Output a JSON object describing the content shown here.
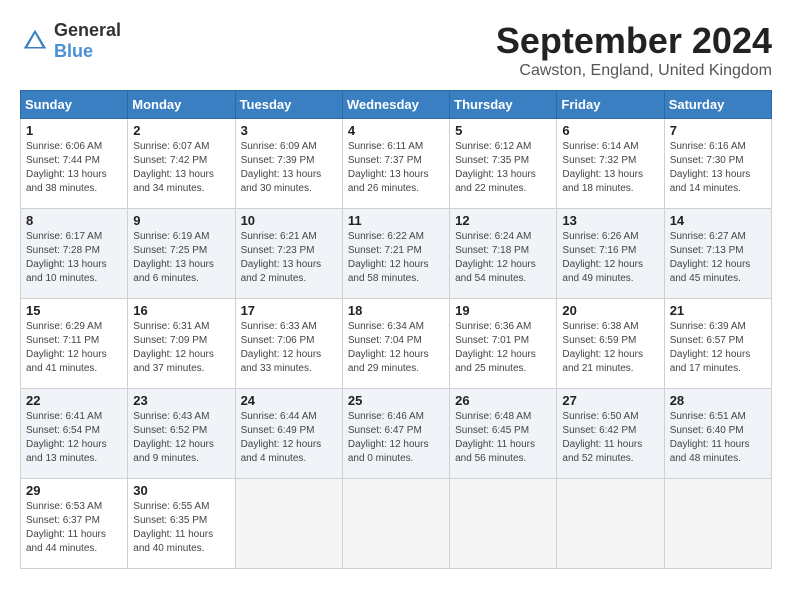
{
  "logo": {
    "text1": "General",
    "text2": "Blue"
  },
  "title": "September 2024",
  "location": "Cawston, England, United Kingdom",
  "weekdays": [
    "Sunday",
    "Monday",
    "Tuesday",
    "Wednesday",
    "Thursday",
    "Friday",
    "Saturday"
  ],
  "weeks": [
    [
      {
        "day": "1",
        "sunrise": "6:06 AM",
        "sunset": "7:44 PM",
        "daylight": "13 hours and 38 minutes."
      },
      {
        "day": "2",
        "sunrise": "6:07 AM",
        "sunset": "7:42 PM",
        "daylight": "13 hours and 34 minutes."
      },
      {
        "day": "3",
        "sunrise": "6:09 AM",
        "sunset": "7:39 PM",
        "daylight": "13 hours and 30 minutes."
      },
      {
        "day": "4",
        "sunrise": "6:11 AM",
        "sunset": "7:37 PM",
        "daylight": "13 hours and 26 minutes."
      },
      {
        "day": "5",
        "sunrise": "6:12 AM",
        "sunset": "7:35 PM",
        "daylight": "13 hours and 22 minutes."
      },
      {
        "day": "6",
        "sunrise": "6:14 AM",
        "sunset": "7:32 PM",
        "daylight": "13 hours and 18 minutes."
      },
      {
        "day": "7",
        "sunrise": "6:16 AM",
        "sunset": "7:30 PM",
        "daylight": "13 hours and 14 minutes."
      }
    ],
    [
      {
        "day": "8",
        "sunrise": "6:17 AM",
        "sunset": "7:28 PM",
        "daylight": "13 hours and 10 minutes."
      },
      {
        "day": "9",
        "sunrise": "6:19 AM",
        "sunset": "7:25 PM",
        "daylight": "13 hours and 6 minutes."
      },
      {
        "day": "10",
        "sunrise": "6:21 AM",
        "sunset": "7:23 PM",
        "daylight": "13 hours and 2 minutes."
      },
      {
        "day": "11",
        "sunrise": "6:22 AM",
        "sunset": "7:21 PM",
        "daylight": "12 hours and 58 minutes."
      },
      {
        "day": "12",
        "sunrise": "6:24 AM",
        "sunset": "7:18 PM",
        "daylight": "12 hours and 54 minutes."
      },
      {
        "day": "13",
        "sunrise": "6:26 AM",
        "sunset": "7:16 PM",
        "daylight": "12 hours and 49 minutes."
      },
      {
        "day": "14",
        "sunrise": "6:27 AM",
        "sunset": "7:13 PM",
        "daylight": "12 hours and 45 minutes."
      }
    ],
    [
      {
        "day": "15",
        "sunrise": "6:29 AM",
        "sunset": "7:11 PM",
        "daylight": "12 hours and 41 minutes."
      },
      {
        "day": "16",
        "sunrise": "6:31 AM",
        "sunset": "7:09 PM",
        "daylight": "12 hours and 37 minutes."
      },
      {
        "day": "17",
        "sunrise": "6:33 AM",
        "sunset": "7:06 PM",
        "daylight": "12 hours and 33 minutes."
      },
      {
        "day": "18",
        "sunrise": "6:34 AM",
        "sunset": "7:04 PM",
        "daylight": "12 hours and 29 minutes."
      },
      {
        "day": "19",
        "sunrise": "6:36 AM",
        "sunset": "7:01 PM",
        "daylight": "12 hours and 25 minutes."
      },
      {
        "day": "20",
        "sunrise": "6:38 AM",
        "sunset": "6:59 PM",
        "daylight": "12 hours and 21 minutes."
      },
      {
        "day": "21",
        "sunrise": "6:39 AM",
        "sunset": "6:57 PM",
        "daylight": "12 hours and 17 minutes."
      }
    ],
    [
      {
        "day": "22",
        "sunrise": "6:41 AM",
        "sunset": "6:54 PM",
        "daylight": "12 hours and 13 minutes."
      },
      {
        "day": "23",
        "sunrise": "6:43 AM",
        "sunset": "6:52 PM",
        "daylight": "12 hours and 9 minutes."
      },
      {
        "day": "24",
        "sunrise": "6:44 AM",
        "sunset": "6:49 PM",
        "daylight": "12 hours and 4 minutes."
      },
      {
        "day": "25",
        "sunrise": "6:46 AM",
        "sunset": "6:47 PM",
        "daylight": "12 hours and 0 minutes."
      },
      {
        "day": "26",
        "sunrise": "6:48 AM",
        "sunset": "6:45 PM",
        "daylight": "11 hours and 56 minutes."
      },
      {
        "day": "27",
        "sunrise": "6:50 AM",
        "sunset": "6:42 PM",
        "daylight": "11 hours and 52 minutes."
      },
      {
        "day": "28",
        "sunrise": "6:51 AM",
        "sunset": "6:40 PM",
        "daylight": "11 hours and 48 minutes."
      }
    ],
    [
      {
        "day": "29",
        "sunrise": "6:53 AM",
        "sunset": "6:37 PM",
        "daylight": "11 hours and 44 minutes."
      },
      {
        "day": "30",
        "sunrise": "6:55 AM",
        "sunset": "6:35 PM",
        "daylight": "11 hours and 40 minutes."
      },
      null,
      null,
      null,
      null,
      null
    ]
  ]
}
